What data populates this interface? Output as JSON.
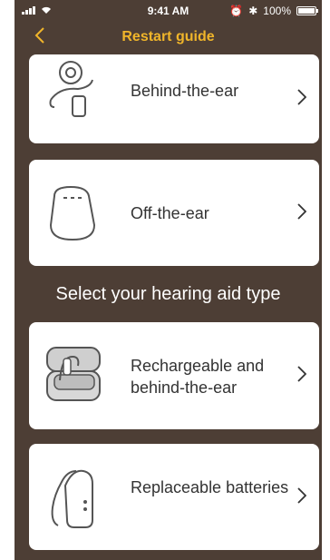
{
  "status": {
    "time": "9:41 AM",
    "battery": "100%"
  },
  "nav": {
    "title": "Restart guide"
  },
  "section": {
    "title": "Select your hearing aid type"
  },
  "cards": [
    {
      "label": "Behind-the-ear"
    },
    {
      "label": "Off-the-ear"
    },
    {
      "label": "Rechargeable and behind-the-ear"
    },
    {
      "label": "Replaceable batteries"
    }
  ],
  "icons": {
    "back": "chevron-left-icon",
    "chevron": "chevron-right-icon"
  },
  "colors": {
    "accent": "#f0b52a",
    "background": "#4d3e35",
    "card": "#ffffff"
  }
}
